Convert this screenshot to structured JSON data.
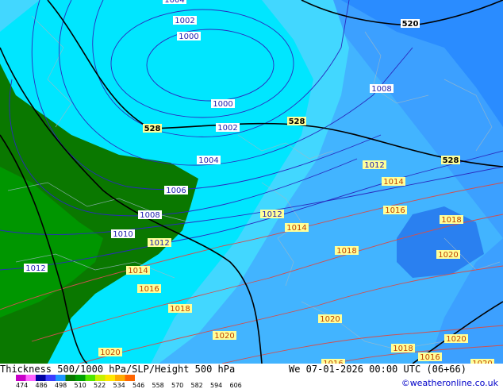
{
  "footer": {
    "title": "Thickness 500/1000 hPa/SLP/Height 500 hPa",
    "datetime": "We 07-01-2026 00:00 UTC (06+66)",
    "credit": "©weatheronline.co.uk"
  },
  "legend": {
    "ticks": [
      "474",
      "486",
      "498",
      "510",
      "522",
      "534",
      "546",
      "558",
      "570",
      "582",
      "594",
      "606"
    ],
    "colors": [
      "#c800c8",
      "#ff64ff",
      "#0000a0",
      "#3c3cff",
      "#1e96ff",
      "#0a7800",
      "#00a000",
      "#50e600",
      "#c8f000",
      "#ffe600",
      "#ffaa00",
      "#ff6400"
    ]
  },
  "map": {
    "thickness_colors": {
      "t510": "#1e78ff",
      "t516": "#3ca0ff",
      "t522": "#42d7ff",
      "t528": "#00e6ff",
      "t534": "#0a7800",
      "t540": "#009600"
    },
    "slp_labels": [
      {
        "text": "1004"
      },
      {
        "text": "1002"
      },
      {
        "text": "1000"
      },
      {
        "text": "1000"
      },
      {
        "text": "1002"
      },
      {
        "text": "1004"
      },
      {
        "text": "1006"
      },
      {
        "text": "1008"
      },
      {
        "text": "1010"
      },
      {
        "text": "1012"
      },
      {
        "text": "1008"
      },
      {
        "text": "1012"
      },
      {
        "text": "1012"
      },
      {
        "text": "1012"
      },
      {
        "text": "1014"
      },
      {
        "text": "1014"
      },
      {
        "text": "1014"
      },
      {
        "text": "1016"
      },
      {
        "text": "1016"
      },
      {
        "text": "1016"
      },
      {
        "text": "1018"
      },
      {
        "text": "1018"
      },
      {
        "text": "1018"
      },
      {
        "text": "1018"
      },
      {
        "text": "1020"
      },
      {
        "text": "1020"
      },
      {
        "text": "1020"
      },
      {
        "text": "1020"
      },
      {
        "text": "1020"
      },
      {
        "text": "1016"
      },
      {
        "text": "1020"
      }
    ],
    "height_labels": [
      {
        "text": "528"
      },
      {
        "text": "528"
      },
      {
        "text": "528"
      },
      {
        "text": "520"
      }
    ]
  }
}
